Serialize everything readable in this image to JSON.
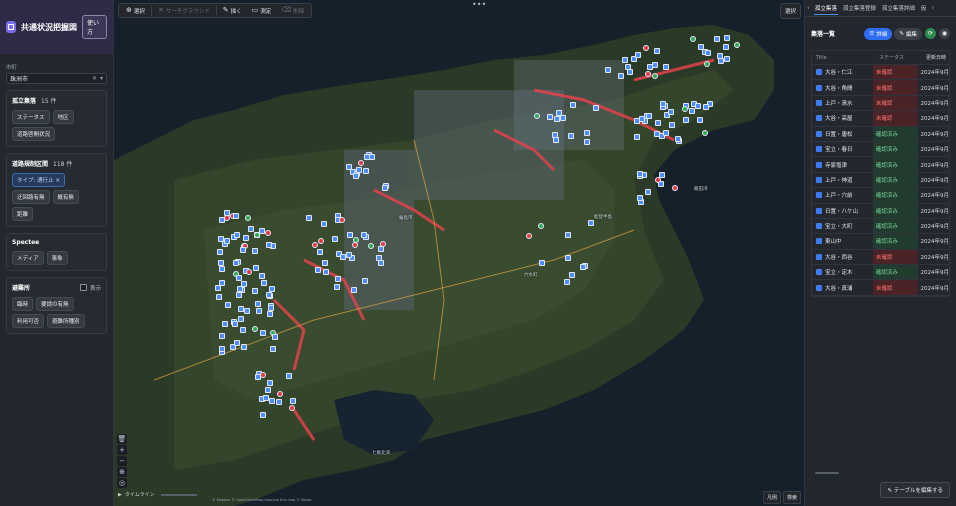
{
  "app": {
    "title": "共通状況把握図",
    "usage_button": "使い方"
  },
  "sidebar": {
    "municipality_label": "市町",
    "municipality_value": "珠洲市",
    "isolated": {
      "title": "孤立集落",
      "count": "15 件",
      "chips": [
        "ステータス",
        "地区",
        "道路啓開状況"
      ]
    },
    "road": {
      "title": "道路規制区間",
      "count": "118 件",
      "chips": [
        {
          "label": "タイプ: 通行止 ✕",
          "active": true
        },
        {
          "label": "迂回路有無",
          "active": false
        },
        {
          "label": "概有無",
          "active": false
        },
        {
          "label": "距離",
          "active": false
        }
      ]
    },
    "spectee": {
      "title": "Spectee",
      "chips": [
        "メディア",
        "事象"
      ]
    },
    "shelter": {
      "title": "避難所",
      "toggle_label": "表示",
      "chips": [
        "臨時",
        "要請の有無",
        "利用可否",
        "避難所種別"
      ]
    }
  },
  "map": {
    "toolbar": [
      {
        "icon": "⊕",
        "label": "選択",
        "disabled": false
      },
      {
        "icon": "✕",
        "label": "サーチグラウンド",
        "disabled": true
      },
      {
        "icon": "✎",
        "label": "描く",
        "disabled": false
      },
      {
        "icon": "▭",
        "label": "測定",
        "disabled": false
      },
      {
        "icon": "⌫",
        "label": "削除",
        "disabled": true
      }
    ],
    "more": "•••",
    "select_button": "選択",
    "timeline_label": "タイムライン",
    "attribution": "© Mapbox © OpenStreetMap Improve this map © Maxar",
    "footer_buttons": [
      "凡例",
      "検索"
    ],
    "place_labels": [
      "飯田湾",
      "七尾北湾",
      "能登半島",
      "輪島市",
      "穴水町"
    ],
    "colors": {
      "road_closed": "#e2434b",
      "marker_blue": "#4d8dff",
      "marker_red": "#e8373f",
      "marker_green": "#34a853"
    }
  },
  "right_panel": {
    "tabs": [
      "孤立集落",
      "孤立集落登録",
      "孤立集落詳細",
      "仮"
    ],
    "list_title": "集落一覧",
    "detail_button": "詳細",
    "edit_button": "編集",
    "columns": [
      "Title",
      "ステータス",
      "更新日時"
    ],
    "rows": [
      {
        "name": "大谷・仁江",
        "status": "未確認",
        "state": "red",
        "date": "2024年9月"
      },
      {
        "name": "大谷・角間",
        "status": "未確認",
        "state": "red",
        "date": "2024年9月"
      },
      {
        "name": "上戸・清水",
        "status": "未確認",
        "state": "red",
        "date": "2024年9月"
      },
      {
        "name": "大谷・高屋",
        "status": "未確認",
        "state": "red",
        "date": "2024年9月"
      },
      {
        "name": "日置・唐松",
        "status": "確認済み",
        "state": "green",
        "date": "2024年9月"
      },
      {
        "name": "宝立・春日",
        "status": "確認済み",
        "state": "green",
        "date": "2024年9月"
      },
      {
        "name": "寺家塩津",
        "status": "確認済み",
        "state": "green",
        "date": "2024年9月"
      },
      {
        "name": "上戸・神道",
        "status": "確認済み",
        "state": "green",
        "date": "2024年9月"
      },
      {
        "name": "上戸・穴前",
        "status": "確認済み",
        "state": "green",
        "date": "2024年9月"
      },
      {
        "name": "日置・八ケ山",
        "status": "確認済み",
        "state": "green",
        "date": "2024年9月"
      },
      {
        "name": "宝立・大町",
        "status": "確認済み",
        "state": "green",
        "date": "2024年9月"
      },
      {
        "name": "東山中",
        "status": "確認済み",
        "state": "green",
        "date": "2024年9月"
      },
      {
        "name": "大谷・西谷",
        "status": "未確認",
        "state": "red",
        "date": "2024年9月"
      },
      {
        "name": "宝立・定木",
        "status": "確認済み",
        "state": "green",
        "date": "2024年9月"
      },
      {
        "name": "大谷・真浦",
        "status": "未確認",
        "state": "red",
        "date": "2024年9月"
      }
    ],
    "edit_table_button": "テーブルを編集する"
  }
}
